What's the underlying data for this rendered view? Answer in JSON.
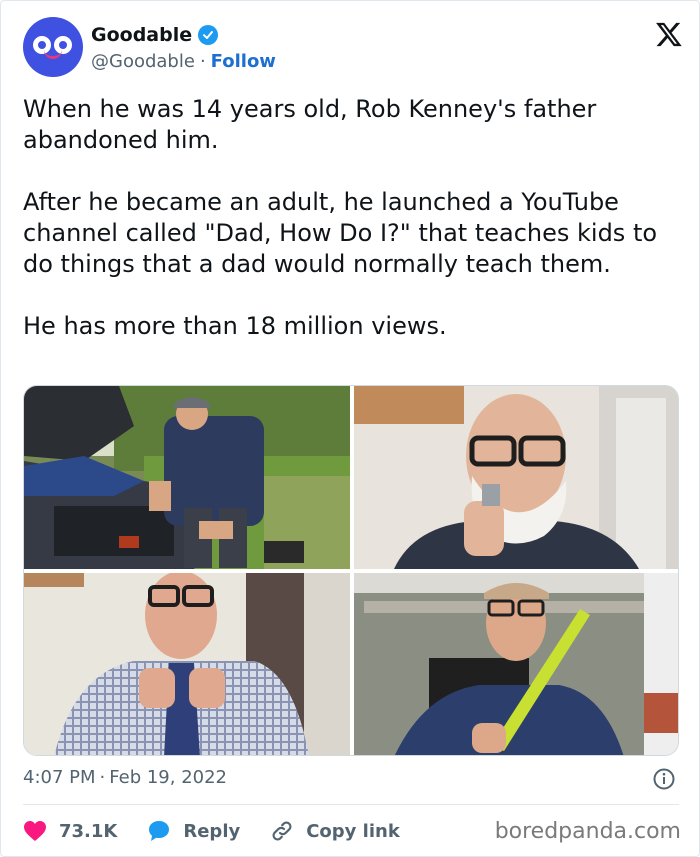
{
  "author": {
    "display_name": "Goodable",
    "handle": "@Goodable",
    "separator": "·",
    "follow_label": "Follow",
    "verified": true,
    "avatar_icon": "goodable-logo-icon",
    "brand_color": "#3f51e0"
  },
  "platform_icon": "x-logo-icon",
  "tweet": {
    "paragraphs": [
      "When he was 14 years old, Rob Kenney's father abandoned him.",
      "After he became an adult, he launched a YouTube channel called \"Dad, How Do I?\" that teaches kids to do things that a dad would normally teach them.",
      "He has more than 18 million views."
    ]
  },
  "media": [
    {
      "alt": "man-fixing-car-engine-photo"
    },
    {
      "alt": "man-shaving-photo"
    },
    {
      "alt": "man-tying-tie-photo"
    },
    {
      "alt": "man-holding-level-photo"
    }
  ],
  "meta": {
    "time": "4:07 PM",
    "separator": "·",
    "date": "Feb 19, 2022"
  },
  "actions": {
    "likes": "73.1K",
    "reply_label": "Reply",
    "copy_link_label": "Copy link"
  },
  "watermark": "boredpanda.com",
  "colors": {
    "like": "#f91880",
    "reply": "#1d9bf0",
    "link": "#1d6fd1",
    "muted": "#536471"
  }
}
